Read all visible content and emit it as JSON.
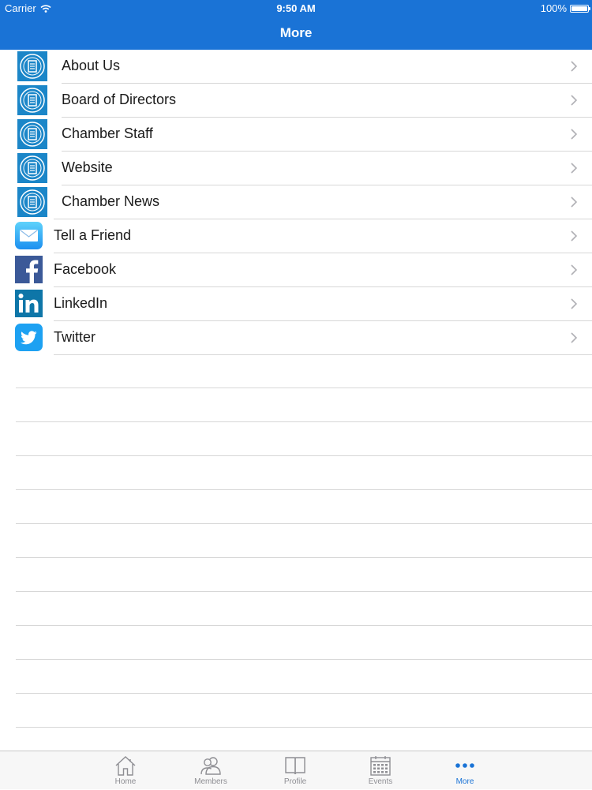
{
  "status_bar": {
    "carrier": "Carrier",
    "time": "9:50 AM",
    "battery": "100%"
  },
  "nav": {
    "title": "More"
  },
  "menu": {
    "items": [
      {
        "label": "About Us",
        "icon": "chamber-logo-icon"
      },
      {
        "label": "Board of Directors",
        "icon": "chamber-logo-icon"
      },
      {
        "label": "Chamber Staff",
        "icon": "chamber-logo-icon"
      },
      {
        "label": "Website",
        "icon": "chamber-logo-icon"
      },
      {
        "label": "Chamber News",
        "icon": "chamber-logo-icon"
      },
      {
        "label": "Tell a Friend",
        "icon": "mail-icon"
      },
      {
        "label": "Facebook",
        "icon": "facebook-icon"
      },
      {
        "label": "LinkedIn",
        "icon": "linkedin-icon"
      },
      {
        "label": "Twitter",
        "icon": "twitter-icon"
      }
    ]
  },
  "tabs": [
    {
      "label": "Home",
      "icon": "home-icon",
      "active": false
    },
    {
      "label": "Members",
      "icon": "members-icon",
      "active": false
    },
    {
      "label": "Profile",
      "icon": "profile-book-icon",
      "active": false
    },
    {
      "label": "Events",
      "icon": "calendar-icon",
      "active": false
    },
    {
      "label": "More",
      "icon": "more-dots-icon",
      "active": true
    }
  ],
  "colors": {
    "brand_blue": "#1a73d6",
    "separator": "#d7d7d7",
    "tab_inactive": "#8e8e93",
    "facebook": "#3b5998",
    "linkedin": "#0e76a8",
    "twitter": "#1da1f2"
  }
}
